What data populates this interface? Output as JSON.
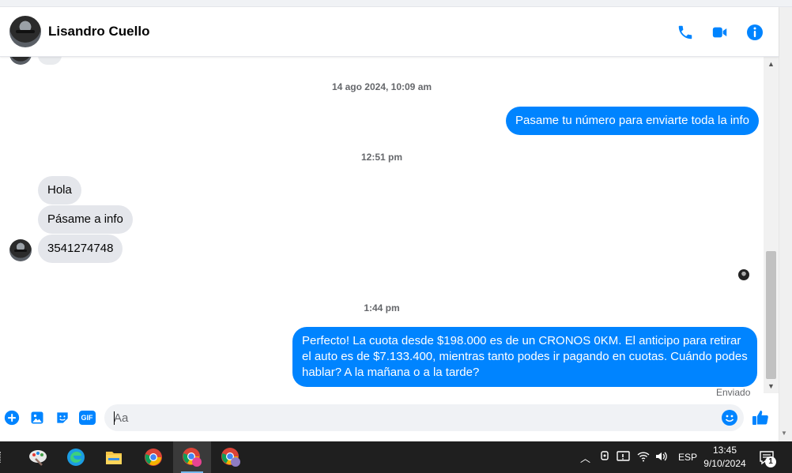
{
  "header": {
    "contact_name": "Lisandro Cuello"
  },
  "conversation": {
    "timestamps": [
      "14 ago 2024, 10:09 am",
      "12:51 pm",
      "1:44 pm"
    ],
    "outgoing": [
      "Pasame tu número para enviarte toda la info",
      "Perfecto! La cuota desde $198.000 es de un CRONOS 0KM. El anticipo para retirar el auto es de $7.133.400, mientras tanto podes ir pagando en cuotas. Cuándo podes hablar? A la mañana o a la tarde?"
    ],
    "incoming": [
      "Hola",
      "Pásame a info",
      "3541274748"
    ],
    "status": "Enviado"
  },
  "composer": {
    "placeholder": "Aa",
    "gif_label": "GIF"
  },
  "taskbar": {
    "language": "ESP",
    "time": "13:45",
    "date": "9/10/2024",
    "notification_count": "1"
  },
  "colors": {
    "accent": "#0084ff",
    "incoming_bubble": "#e4e6eb",
    "taskbar": "#1f1f1f"
  }
}
